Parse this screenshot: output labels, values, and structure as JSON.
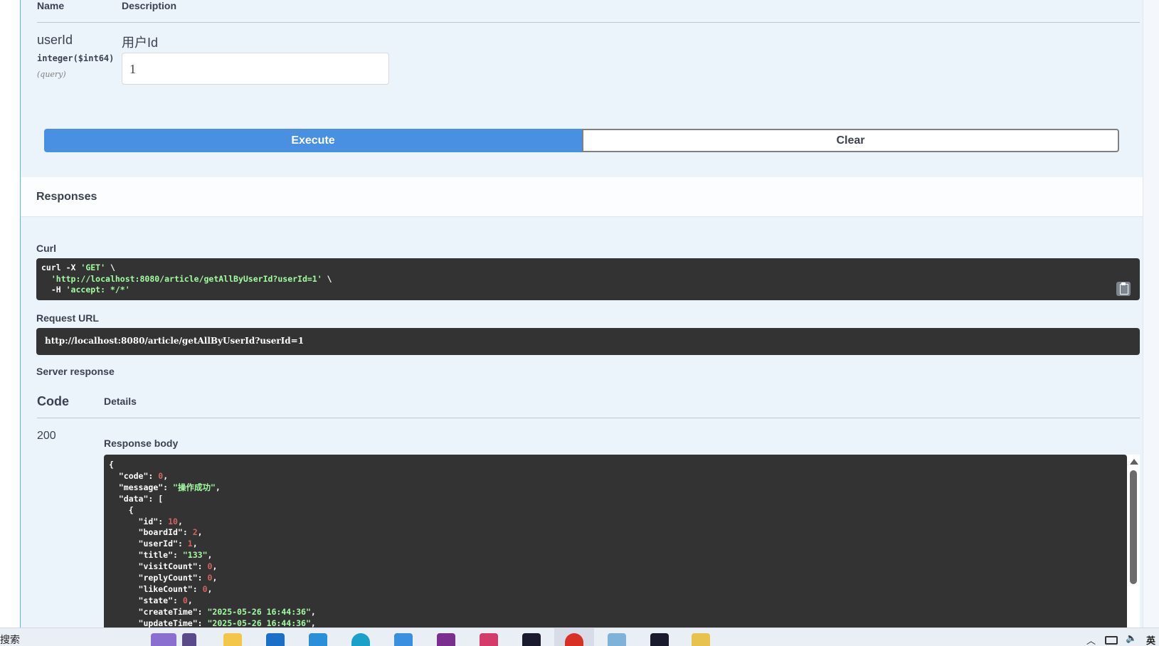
{
  "parameters": {
    "header_name": "Name",
    "header_description": "Description",
    "param": {
      "name": "userId",
      "type": "integer($int64)",
      "location": "(query)",
      "description": "用户Id",
      "value": "1"
    }
  },
  "buttons": {
    "execute": "Execute",
    "clear": "Clear"
  },
  "responses": {
    "title": "Responses",
    "curl_label": "Curl",
    "curl_line1_cmd": "curl -X ",
    "curl_line1_method": "'GET'",
    "curl_line1_tail": " \\",
    "curl_line2_url": "'http://localhost:8080/article/getAllByUserId?userId=1'",
    "curl_line2_tail": " \\",
    "curl_line3_cmd": "  -H ",
    "curl_line3_header": "'accept: */*'",
    "request_url_label": "Request URL",
    "request_url": "http://localhost:8080/article/getAllByUserId?userId=1",
    "server_response_label": "Server response",
    "code_header": "Code",
    "details_header": "Details",
    "code": "200",
    "response_body_label": "Response body"
  },
  "response_body": {
    "open_brace": "{",
    "code_key": "\"code\"",
    "code_val": "0",
    "message_key": "\"message\"",
    "message_val": "\"操作成功\"",
    "data_key": "\"data\"",
    "data_open": "[",
    "item_open": "{",
    "fields": [
      {
        "key": "\"id\"",
        "val": "10",
        "type": "n"
      },
      {
        "key": "\"boardId\"",
        "val": "2",
        "type": "n"
      },
      {
        "key": "\"userId\"",
        "val": "1",
        "type": "n"
      },
      {
        "key": "\"title\"",
        "val": "\"133\"",
        "type": "s"
      },
      {
        "key": "\"visitCount\"",
        "val": "0",
        "type": "n"
      },
      {
        "key": "\"replyCount\"",
        "val": "0",
        "type": "n"
      },
      {
        "key": "\"likeCount\"",
        "val": "0",
        "type": "n"
      },
      {
        "key": "\"state\"",
        "val": "0",
        "type": "n"
      },
      {
        "key": "\"createTime\"",
        "val": "\"2025-05-26 16:44:36\"",
        "type": "s"
      },
      {
        "key": "\"updateTime\"",
        "val": "\"2025-05-26 16:44:36\"",
        "type": "s"
      }
    ]
  },
  "taskbar": {
    "search_text": "搜索",
    "tray_lang": "英",
    "apps": [
      "file-explorer",
      "outlook",
      "vscode",
      "edge",
      "ms-store",
      "onenote",
      "intellij",
      "qq",
      "chrome",
      "notepad",
      "qq-2",
      "app-yellow"
    ],
    "colors": {
      "file-explorer": "#f3c64a",
      "outlook": "#1b6fc7",
      "vscode": "#2a8fd8",
      "edge": "#1aa1c9",
      "ms-store": "#3b8fe0",
      "onenote": "#7a2f8f",
      "intellij": "#d43b6a",
      "qq": "#1a1a2e",
      "chrome": "#d93025",
      "notepad": "#7fb2d9",
      "qq-2": "#1a1a2e",
      "app-yellow": "#e8c24f"
    }
  },
  "colors": {
    "execute_bg": "#4990e2",
    "code_bg": "#333333",
    "string": "#a2fca2",
    "number": "#d36363",
    "opblock_bg": "#ebf3fb"
  }
}
